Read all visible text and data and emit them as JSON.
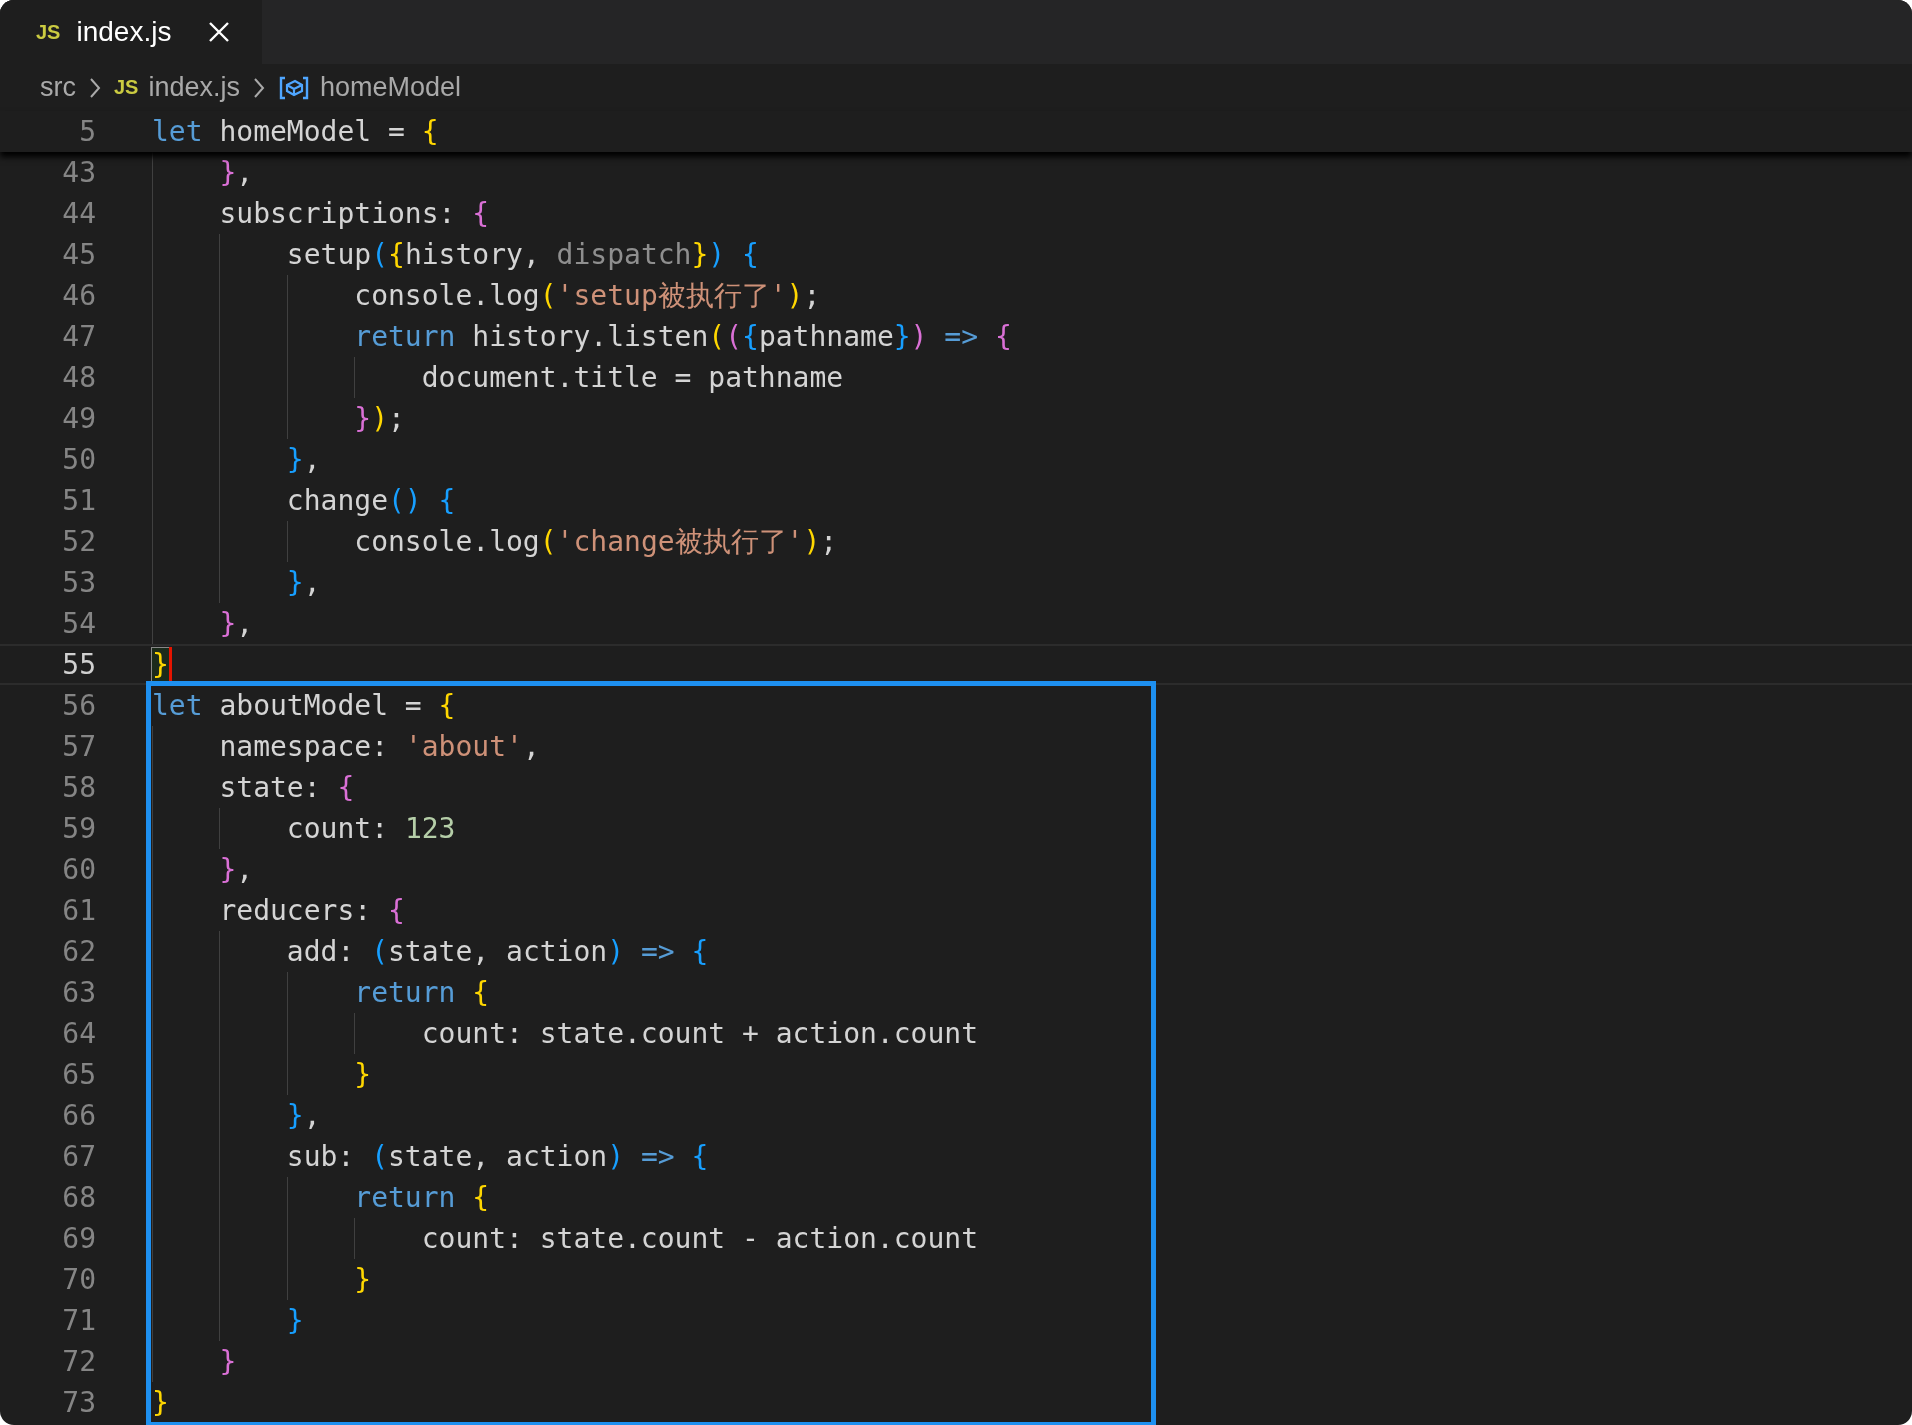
{
  "tab": {
    "icon_label": "JS",
    "label": "index.js",
    "selected": true
  },
  "breadcrumbs": [
    {
      "kind": "folder",
      "label": "src"
    },
    {
      "kind": "file",
      "icon_label": "JS",
      "label": "index.js"
    },
    {
      "kind": "symbol",
      "label": "homeModel"
    }
  ],
  "sticky_line": {
    "number": "5",
    "tokens": [
      {
        "kind": "kw",
        "text": "let "
      },
      {
        "kind": "plain",
        "text": "homeModel = "
      },
      {
        "kind": "b1",
        "text": "{"
      }
    ]
  },
  "lines": [
    {
      "number": "43",
      "current": false,
      "boxed": false,
      "tokens": [
        {
          "kind": "b2",
          "text": "    }"
        },
        {
          "kind": "plain",
          "text": ","
        }
      ]
    },
    {
      "number": "44",
      "current": false,
      "boxed": false,
      "tokens": [
        {
          "kind": "plain",
          "text": "    subscriptions: "
        },
        {
          "kind": "b2",
          "text": "{"
        }
      ]
    },
    {
      "number": "45",
      "current": false,
      "boxed": false,
      "tokens": [
        {
          "kind": "plain",
          "text": "        setup"
        },
        {
          "kind": "b3",
          "text": "("
        },
        {
          "kind": "b1",
          "text": "{"
        },
        {
          "kind": "plain",
          "text": "history, "
        },
        {
          "kind": "dim",
          "text": "dispatch"
        },
        {
          "kind": "b1",
          "text": "}"
        },
        {
          "kind": "b3",
          "text": ")"
        },
        {
          "kind": "b3",
          "text": " {"
        }
      ]
    },
    {
      "number": "46",
      "current": false,
      "boxed": false,
      "tokens": [
        {
          "kind": "plain",
          "text": "            console.log"
        },
        {
          "kind": "b1",
          "text": "("
        },
        {
          "kind": "str",
          "text": "'setup被执行了'"
        },
        {
          "kind": "b1",
          "text": ")"
        },
        {
          "kind": "plain",
          "text": ";"
        }
      ]
    },
    {
      "number": "47",
      "current": false,
      "boxed": false,
      "tokens": [
        {
          "kind": "kw",
          "text": "            return "
        },
        {
          "kind": "plain",
          "text": "history.listen"
        },
        {
          "kind": "b1",
          "text": "("
        },
        {
          "kind": "b2",
          "text": "("
        },
        {
          "kind": "b3",
          "text": "{"
        },
        {
          "kind": "plain",
          "text": "pathname"
        },
        {
          "kind": "b3",
          "text": "}"
        },
        {
          "kind": "b2",
          "text": ")"
        },
        {
          "kind": "kw",
          "text": " => "
        },
        {
          "kind": "b2",
          "text": "{"
        }
      ]
    },
    {
      "number": "48",
      "current": false,
      "boxed": false,
      "tokens": [
        {
          "kind": "plain",
          "text": "                document.title = pathname"
        }
      ]
    },
    {
      "number": "49",
      "current": false,
      "boxed": false,
      "tokens": [
        {
          "kind": "b2",
          "text": "            }"
        },
        {
          "kind": "b1",
          "text": ")"
        },
        {
          "kind": "plain",
          "text": ";"
        }
      ]
    },
    {
      "number": "50",
      "current": false,
      "boxed": false,
      "tokens": [
        {
          "kind": "b3",
          "text": "        }"
        },
        {
          "kind": "plain",
          "text": ","
        }
      ]
    },
    {
      "number": "51",
      "current": false,
      "boxed": false,
      "tokens": [
        {
          "kind": "plain",
          "text": "        change"
        },
        {
          "kind": "b3",
          "text": "()"
        },
        {
          "kind": "b3",
          "text": " {"
        }
      ]
    },
    {
      "number": "52",
      "current": false,
      "boxed": false,
      "tokens": [
        {
          "kind": "plain",
          "text": "            console.log"
        },
        {
          "kind": "b1",
          "text": "("
        },
        {
          "kind": "str",
          "text": "'change被执行了'"
        },
        {
          "kind": "b1",
          "text": ")"
        },
        {
          "kind": "plain",
          "text": ";"
        }
      ]
    },
    {
      "number": "53",
      "current": false,
      "boxed": false,
      "tokens": [
        {
          "kind": "b3",
          "text": "        }"
        },
        {
          "kind": "plain",
          "text": ","
        }
      ]
    },
    {
      "number": "54",
      "current": false,
      "boxed": false,
      "tokens": [
        {
          "kind": "b2",
          "text": "    }"
        },
        {
          "kind": "plain",
          "text": ","
        }
      ]
    },
    {
      "number": "55",
      "current": true,
      "boxed": false,
      "tokens": [
        {
          "kind": "b1",
          "text": "}"
        }
      ]
    },
    {
      "number": "56",
      "current": false,
      "boxed": true,
      "tokens": [
        {
          "kind": "kw",
          "text": "let "
        },
        {
          "kind": "plain",
          "text": "aboutModel = "
        },
        {
          "kind": "b1",
          "text": "{"
        }
      ]
    },
    {
      "number": "57",
      "current": false,
      "boxed": true,
      "tokens": [
        {
          "kind": "plain",
          "text": "    namespace: "
        },
        {
          "kind": "str",
          "text": "'about'"
        },
        {
          "kind": "plain",
          "text": ","
        }
      ]
    },
    {
      "number": "58",
      "current": false,
      "boxed": true,
      "tokens": [
        {
          "kind": "plain",
          "text": "    state: "
        },
        {
          "kind": "b2",
          "text": "{"
        }
      ]
    },
    {
      "number": "59",
      "current": false,
      "boxed": true,
      "tokens": [
        {
          "kind": "plain",
          "text": "        count: "
        },
        {
          "kind": "num",
          "text": "123"
        }
      ]
    },
    {
      "number": "60",
      "current": false,
      "boxed": true,
      "tokens": [
        {
          "kind": "b2",
          "text": "    }"
        },
        {
          "kind": "plain",
          "text": ","
        }
      ]
    },
    {
      "number": "61",
      "current": false,
      "boxed": true,
      "tokens": [
        {
          "kind": "plain",
          "text": "    reducers: "
        },
        {
          "kind": "b2",
          "text": "{"
        }
      ]
    },
    {
      "number": "62",
      "current": false,
      "boxed": true,
      "tokens": [
        {
          "kind": "plain",
          "text": "        add: "
        },
        {
          "kind": "b3",
          "text": "("
        },
        {
          "kind": "plain",
          "text": "state, action"
        },
        {
          "kind": "b3",
          "text": ")"
        },
        {
          "kind": "kw",
          "text": " => "
        },
        {
          "kind": "b3",
          "text": "{"
        }
      ]
    },
    {
      "number": "63",
      "current": false,
      "boxed": true,
      "tokens": [
        {
          "kind": "kw",
          "text": "            return "
        },
        {
          "kind": "b1",
          "text": "{"
        }
      ]
    },
    {
      "number": "64",
      "current": false,
      "boxed": true,
      "tokens": [
        {
          "kind": "plain",
          "text": "                count: state.count + action.count"
        }
      ]
    },
    {
      "number": "65",
      "current": false,
      "boxed": true,
      "tokens": [
        {
          "kind": "b1",
          "text": "            }"
        }
      ]
    },
    {
      "number": "66",
      "current": false,
      "boxed": true,
      "tokens": [
        {
          "kind": "b3",
          "text": "        }"
        },
        {
          "kind": "plain",
          "text": ","
        }
      ]
    },
    {
      "number": "67",
      "current": false,
      "boxed": true,
      "tokens": [
        {
          "kind": "plain",
          "text": "        sub: "
        },
        {
          "kind": "b3",
          "text": "("
        },
        {
          "kind": "plain",
          "text": "state, action"
        },
        {
          "kind": "b3",
          "text": ")"
        },
        {
          "kind": "kw",
          "text": " => "
        },
        {
          "kind": "b3",
          "text": "{"
        }
      ]
    },
    {
      "number": "68",
      "current": false,
      "boxed": true,
      "tokens": [
        {
          "kind": "kw",
          "text": "            return "
        },
        {
          "kind": "b1",
          "text": "{"
        }
      ]
    },
    {
      "number": "69",
      "current": false,
      "boxed": true,
      "tokens": [
        {
          "kind": "plain",
          "text": "                count: state.count - action.count"
        }
      ]
    },
    {
      "number": "70",
      "current": false,
      "boxed": true,
      "tokens": [
        {
          "kind": "b1",
          "text": "            }"
        }
      ]
    },
    {
      "number": "71",
      "current": false,
      "boxed": true,
      "tokens": [
        {
          "kind": "b3",
          "text": "        }"
        }
      ]
    },
    {
      "number": "72",
      "current": false,
      "boxed": true,
      "tokens": [
        {
          "kind": "b2",
          "text": "    }"
        }
      ]
    },
    {
      "number": "73",
      "current": false,
      "boxed": true,
      "tokens": [
        {
          "kind": "b1",
          "text": "}"
        }
      ]
    }
  ]
}
